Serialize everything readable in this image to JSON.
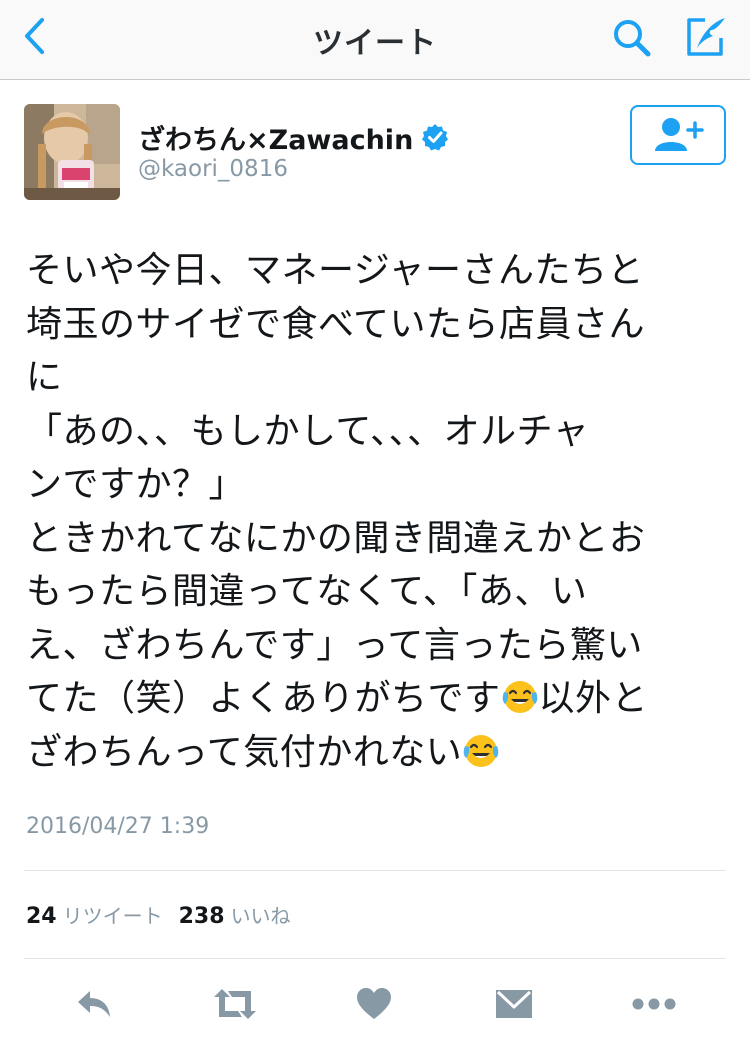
{
  "navbar": {
    "title": "ツイート",
    "back_icon": "chevron-left-icon",
    "search_icon": "search-icon",
    "compose_icon": "compose-icon",
    "accent": "#1da1f2"
  },
  "tweet": {
    "user": {
      "display_name": "ざわちん×Zawachin",
      "handle": "@kaori_0816",
      "verified": true
    },
    "lines": [
      "そいや今日、マネージャーさんたちと",
      "埼玉のサイゼで食べていたら店員さん",
      "に",
      "「あの、、もしかして、、、オルチャ",
      "ンですか？」",
      "ときかれてなにかの聞き間違えかとお",
      "もったら間違ってなくて、「あ、い",
      "え、ざわちんです」って言ったら驚い",
      "てた（笑）よくありがちです",
      "以外と",
      "ざわちんって気付かれない"
    ],
    "timestamp": "2016/04/27 1:39",
    "retweet_count": "24",
    "retweet_label": "リツイート",
    "like_count": "238",
    "like_label": "いいね"
  },
  "actions": {
    "reply_icon": "reply-icon",
    "retweet_icon": "retweet-icon",
    "like_icon": "heart-icon",
    "dm_icon": "envelope-icon",
    "more_icon": "more-icon",
    "color": "#8899a6"
  },
  "emoji_icon": "tears-of-joy-emoji-icon"
}
